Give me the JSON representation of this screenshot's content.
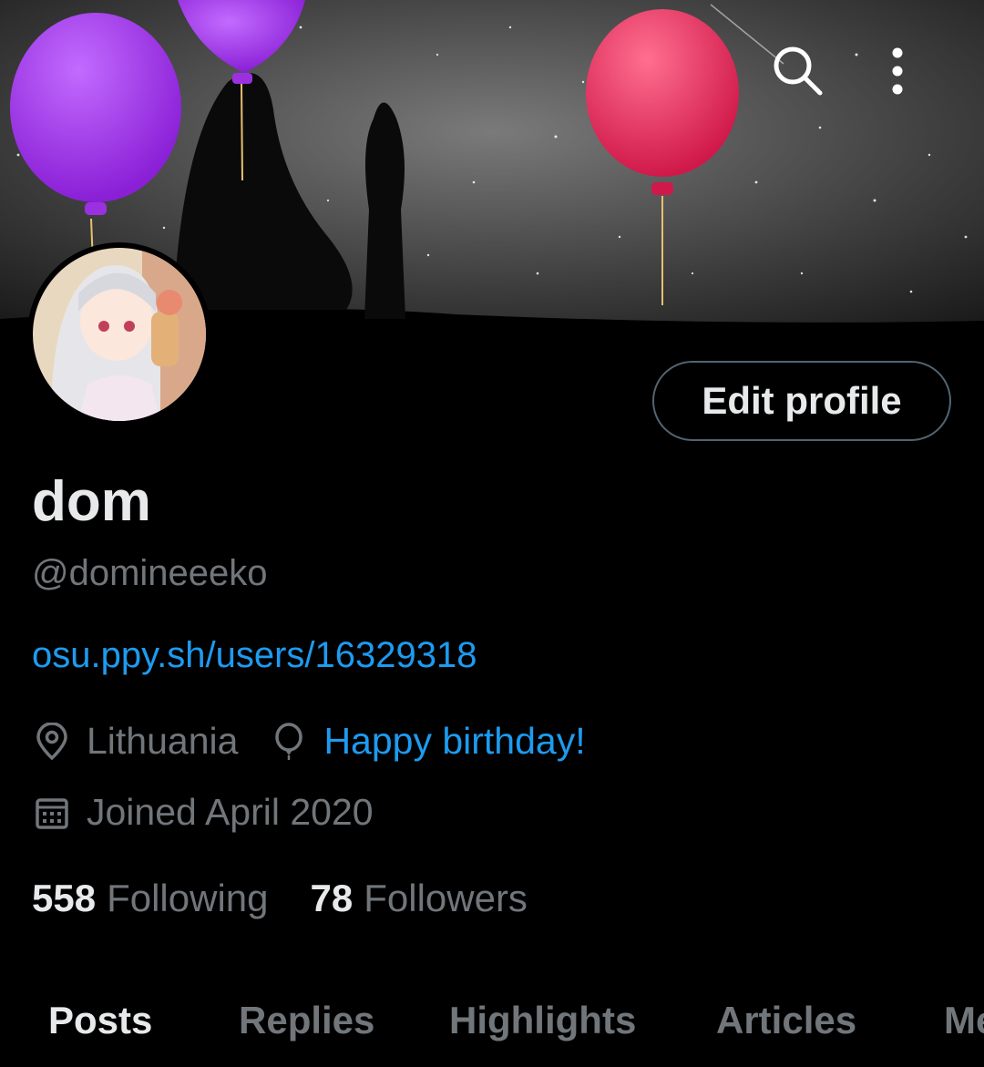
{
  "banner": {
    "search_icon": "search-icon",
    "more_icon": "more-vertical-icon"
  },
  "profile": {
    "edit_label": "Edit profile",
    "display_name": "dom",
    "handle": "@domineeeko",
    "website": "osu.ppy.sh/users/16329318",
    "location": "Lithuania",
    "birthday": "Happy birthday!",
    "joined": "Joined April 2020"
  },
  "stats": {
    "following_count": "558",
    "following_label": "Following",
    "followers_count": "78",
    "followers_label": "Followers"
  },
  "tabs": [
    "Posts",
    "Replies",
    "Highlights",
    "Articles",
    "Media"
  ],
  "colors": {
    "accent": "#1d9bf0",
    "text_primary": "#e7e9ea",
    "text_secondary": "#71767b",
    "background": "#000000"
  }
}
